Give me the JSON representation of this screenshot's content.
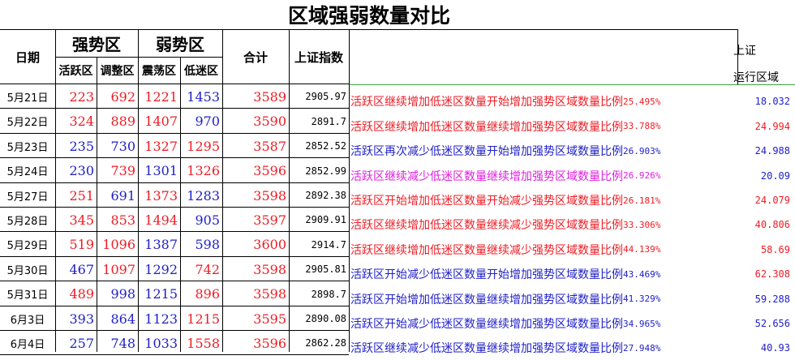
{
  "title": "区域强弱数量对比",
  "header": {
    "date": "日期",
    "strong": "强势区",
    "weak": "弱势区",
    "active": "活跃区",
    "adjust": "调整区",
    "oscillate": "震荡区",
    "low": "低迷区",
    "total": "合计",
    "sh_index": "上证指数",
    "sh_label_1": "上证",
    "sh_label_2": "运行区域"
  },
  "colors": {
    "red": "#ee1c24",
    "blue": "#2020c8",
    "magenta": "#e020e0",
    "green_rule": "#3aa63a"
  },
  "rows": [
    {
      "date": "5月21日",
      "active": "223",
      "active_c": "red",
      "adjust": "692",
      "adjust_c": "red",
      "osc": "1221",
      "osc_c": "red",
      "low": "1453",
      "low_c": "blue",
      "total": "3589",
      "sh": "2905.97",
      "note": "活跃区继续增加低迷区数量开始增加强势区域数量比例",
      "pct": "25.495%",
      "note_c": "red",
      "region": "18.032",
      "region_c": "blue"
    },
    {
      "date": "5月22日",
      "active": "324",
      "active_c": "red",
      "adjust": "889",
      "adjust_c": "red",
      "osc": "1407",
      "osc_c": "red",
      "low": "970",
      "low_c": "blue",
      "total": "3590",
      "sh": "2891.7",
      "note": "活跃区继续增加低迷区数量继续增加强势区域数量比例",
      "pct": "33.788%",
      "note_c": "red",
      "region": "24.994",
      "region_c": "red"
    },
    {
      "date": "5月23日",
      "active": "235",
      "active_c": "blue",
      "adjust": "730",
      "adjust_c": "blue",
      "osc": "1327",
      "osc_c": "red",
      "low": "1295",
      "low_c": "red",
      "total": "3587",
      "sh": "2852.52",
      "note": "活跃区再次减少低迷区数量开始增加强势区域数量比例",
      "pct": "26.903%",
      "note_c": "blue",
      "region": "24.988",
      "region_c": "blue"
    },
    {
      "date": "5月24日",
      "active": "230",
      "active_c": "blue",
      "adjust": "739",
      "adjust_c": "red",
      "osc": "1301",
      "osc_c": "blue",
      "low": "1326",
      "low_c": "red",
      "total": "3596",
      "sh": "2852.99",
      "note": "活跃区继续减少低迷区数量继续增加强势区域数量比例",
      "pct": "26.926%",
      "note_c": "magenta",
      "region": "20.09",
      "region_c": "blue"
    },
    {
      "date": "5月27日",
      "active": "251",
      "active_c": "red",
      "adjust": "691",
      "adjust_c": "blue",
      "osc": "1373",
      "osc_c": "red",
      "low": "1283",
      "low_c": "blue",
      "total": "3598",
      "sh": "2892.38",
      "note": "活跃区开始增加低迷区数量开始减少强势区域数量比例",
      "pct": "26.181%",
      "note_c": "red",
      "region": "24.079",
      "region_c": "red"
    },
    {
      "date": "5月28日",
      "active": "345",
      "active_c": "red",
      "adjust": "853",
      "adjust_c": "red",
      "osc": "1494",
      "osc_c": "red",
      "low": "905",
      "low_c": "blue",
      "total": "3597",
      "sh": "2909.91",
      "note": "活跃区继续增加低迷区数量继续减少强势区域数量比例",
      "pct": "33.306%",
      "note_c": "red",
      "region": "40.806",
      "region_c": "red"
    },
    {
      "date": "5月29日",
      "active": "519",
      "active_c": "red",
      "adjust": "1096",
      "adjust_c": "red",
      "osc": "1387",
      "osc_c": "blue",
      "low": "598",
      "low_c": "blue",
      "total": "3600",
      "sh": "2914.7",
      "note": "活跃区继续增加低迷区数量继续减少强势区域数量比例",
      "pct": "44.139%",
      "note_c": "red",
      "region": "58.69",
      "region_c": "red"
    },
    {
      "date": "5月30日",
      "active": "467",
      "active_c": "blue",
      "adjust": "1097",
      "adjust_c": "red",
      "osc": "1292",
      "osc_c": "blue",
      "low": "742",
      "low_c": "red",
      "total": "3598",
      "sh": "2905.81",
      "note": "活跃区开始减少低迷区数量开始增加强势区域数量比例",
      "pct": "43.469%",
      "note_c": "blue",
      "region": "62.308",
      "region_c": "red"
    },
    {
      "date": "5月31日",
      "active": "489",
      "active_c": "red",
      "adjust": "998",
      "adjust_c": "blue",
      "osc": "1215",
      "osc_c": "blue",
      "low": "896",
      "low_c": "red",
      "total": "3598",
      "sh": "2898.7",
      "note": "活跃区开始增加低迷区数量继续增加强势区域数量比例",
      "pct": "41.329%",
      "note_c": "blue",
      "region": "59.288",
      "region_c": "blue"
    },
    {
      "date": "6月3日",
      "active": "393",
      "active_c": "blue",
      "adjust": "864",
      "adjust_c": "blue",
      "osc": "1123",
      "osc_c": "blue",
      "low": "1215",
      "low_c": "red",
      "total": "3595",
      "sh": "2890.08",
      "note": "活跃区开始减少低迷区数量继续增加强势区域数量比例",
      "pct": "34.965%",
      "note_c": "blue",
      "region": "52.656",
      "region_c": "blue"
    },
    {
      "date": "6月4日",
      "active": "257",
      "active_c": "blue",
      "adjust": "748",
      "adjust_c": "blue",
      "osc": "1033",
      "osc_c": "blue",
      "low": "1558",
      "low_c": "red",
      "total": "3596",
      "sh": "2862.28",
      "note": "活跃区继续减少低迷区数量继续增加强势区域数量比例",
      "pct": "27.948%",
      "note_c": "blue",
      "region": "40.93",
      "region_c": "blue"
    }
  ]
}
